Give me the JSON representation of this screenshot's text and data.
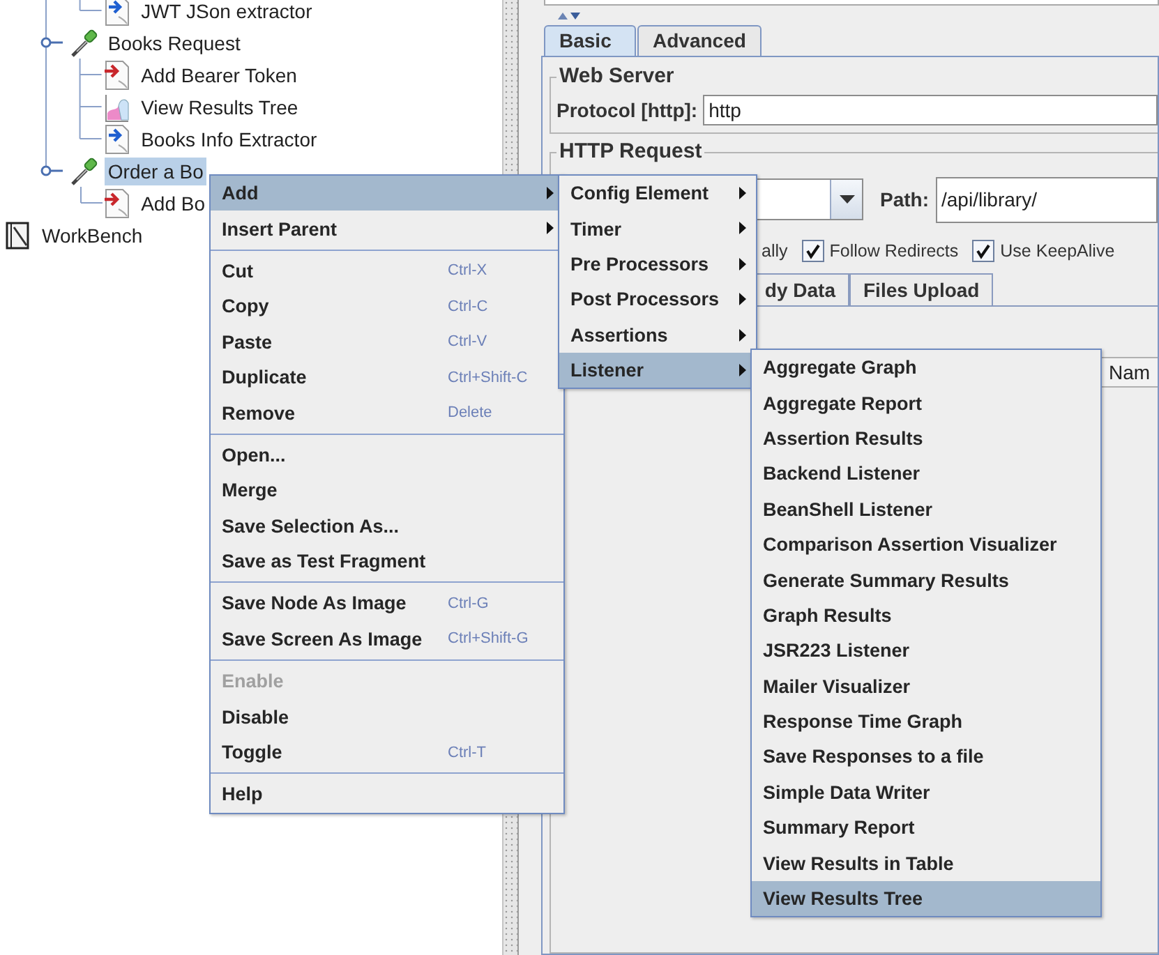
{
  "tree": {
    "items": [
      {
        "children": [
          {
            "children": [
              {
                "children": [
                  {
                    "label": "JWT JSon extractor",
                    "kind": "extractor",
                    "selected": false
                  }
                ]
              },
              {
                "label": "Books Request",
                "kind": "sampler",
                "selected": false,
                "expanded": true,
                "children": [
                  {
                    "label": "Add Bearer Token",
                    "kind": "preprocessor",
                    "selected": false
                  },
                  {
                    "label": "View Results Tree",
                    "kind": "listener",
                    "selected": false
                  },
                  {
                    "label": "Books Info Extractor",
                    "kind": "extractor",
                    "selected": false
                  }
                ]
              },
              {
                "label": "Order a Bo",
                "kind": "sampler",
                "selected": true,
                "expanded": true,
                "children": [
                  {
                    "label": "Add Bo",
                    "kind": "preprocessor",
                    "selected": false
                  }
                ]
              }
            ]
          }
        ]
      },
      {
        "label": "WorkBench",
        "kind": "workbench",
        "selected": false
      }
    ]
  },
  "editor": {
    "top_tabs": [
      {
        "label": "Basic",
        "selected": true
      },
      {
        "label": "Advanced",
        "selected": false
      }
    ],
    "web_server": {
      "legend": "Web Server",
      "protocol_label": "Protocol [http]:",
      "protocol_value": "http"
    },
    "http_request": {
      "legend": "HTTP Request",
      "path_label": "Path:",
      "path_value": "/api/library/",
      "covered_label": "ally",
      "checkboxes": [
        {
          "label": "Follow Redirects",
          "checked": true
        },
        {
          "label": "Use KeepAlive",
          "checked": true
        }
      ],
      "tabs": [
        "dy Data",
        "Files Upload"
      ],
      "table_column": "Nam"
    }
  },
  "context_menu": {
    "groups": [
      {
        "items": [
          {
            "label": "Add",
            "selected": true,
            "has_submenu": true
          },
          {
            "label": "Insert Parent",
            "selected": false,
            "has_submenu": true
          }
        ]
      },
      {
        "items": [
          {
            "label": "Cut",
            "shortcut": "Ctrl-X",
            "selected": false,
            "has_submenu": false
          },
          {
            "label": "Copy",
            "shortcut": "Ctrl-C",
            "selected": false,
            "has_submenu": false
          },
          {
            "label": "Paste",
            "shortcut": "Ctrl-V",
            "selected": false,
            "has_submenu": false
          },
          {
            "label": "Duplicate",
            "shortcut": "Ctrl+Shift-C",
            "selected": false,
            "has_submenu": false
          },
          {
            "label": "Remove",
            "shortcut": "Delete",
            "selected": false,
            "has_submenu": false
          }
        ]
      },
      {
        "items": [
          {
            "label": "Open...",
            "selected": false,
            "has_submenu": false
          },
          {
            "label": "Merge",
            "selected": false,
            "has_submenu": false
          },
          {
            "label": "Save Selection As...",
            "selected": false,
            "has_submenu": false
          },
          {
            "label": "Save as Test Fragment",
            "selected": false,
            "has_submenu": false
          }
        ]
      },
      {
        "items": [
          {
            "label": "Save Node As Image",
            "shortcut": "Ctrl-G",
            "selected": false,
            "has_submenu": false
          },
          {
            "label": "Save Screen As Image",
            "shortcut": "Ctrl+Shift-G",
            "selected": false,
            "has_submenu": false
          }
        ]
      },
      {
        "items": [
          {
            "label": "Enable",
            "selected": false,
            "disabled": true,
            "has_submenu": false
          },
          {
            "label": "Disable",
            "selected": false,
            "disabled": false,
            "has_submenu": false
          },
          {
            "label": "Toggle",
            "shortcut": "Ctrl-T",
            "selected": false,
            "disabled": false,
            "has_submenu": false
          }
        ]
      },
      {
        "items": [
          {
            "label": "Help",
            "selected": false,
            "has_submenu": false
          }
        ]
      }
    ]
  },
  "add_submenu": {
    "items": [
      {
        "label": "Config Element",
        "selected": false,
        "has_submenu": true
      },
      {
        "label": "Timer",
        "selected": false,
        "has_submenu": true
      },
      {
        "label": "Pre Processors",
        "selected": false,
        "has_submenu": true
      },
      {
        "label": "Post Processors",
        "selected": false,
        "has_submenu": true
      },
      {
        "label": "Assertions",
        "selected": false,
        "has_submenu": true
      },
      {
        "label": "Listener",
        "selected": true,
        "has_submenu": true
      }
    ]
  },
  "listener_submenu": {
    "items": [
      {
        "label": "Aggregate Graph",
        "selected": false,
        "has_submenu": false
      },
      {
        "label": "Aggregate Report",
        "selected": false,
        "has_submenu": false
      },
      {
        "label": "Assertion Results",
        "selected": false,
        "has_submenu": false
      },
      {
        "label": "Backend Listener",
        "selected": false,
        "has_submenu": false
      },
      {
        "label": "BeanShell Listener",
        "selected": false,
        "has_submenu": false
      },
      {
        "label": "Comparison Assertion Visualizer",
        "selected": false,
        "has_submenu": false
      },
      {
        "label": "Generate Summary Results",
        "selected": false,
        "has_submenu": false
      },
      {
        "label": "Graph Results",
        "selected": false,
        "has_submenu": false
      },
      {
        "label": "JSR223 Listener",
        "selected": false,
        "has_submenu": false
      },
      {
        "label": "Mailer Visualizer",
        "selected": false,
        "has_submenu": false
      },
      {
        "label": "Response Time Graph",
        "selected": false,
        "has_submenu": false
      },
      {
        "label": "Save Responses to a file",
        "selected": false,
        "has_submenu": false
      },
      {
        "label": "Simple Data Writer",
        "selected": false,
        "has_submenu": false
      },
      {
        "label": "Summary Report",
        "selected": false,
        "has_submenu": false
      },
      {
        "label": "View Results in Table",
        "selected": false,
        "has_submenu": false
      },
      {
        "label": "View Results Tree",
        "selected": true,
        "has_submenu": false
      }
    ]
  }
}
